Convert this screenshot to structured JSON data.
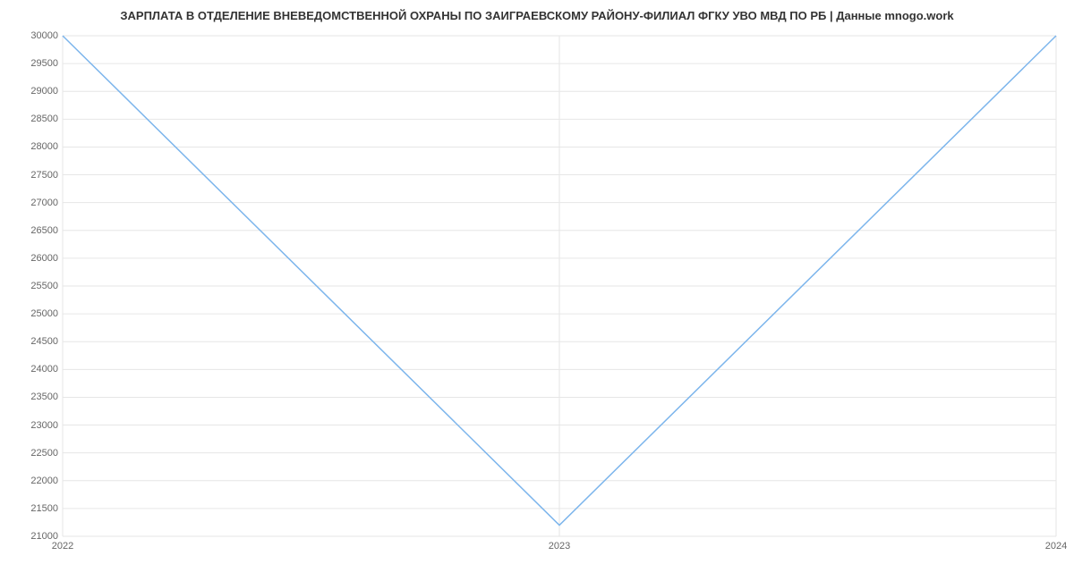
{
  "chart_data": {
    "type": "line",
    "title": "ЗАРПЛАТА В ОТДЕЛЕНИЕ ВНЕВЕДОМСТВЕННОЙ ОХРАНЫ ПО ЗАИГРАЕВСКОМУ РАЙОНУ-ФИЛИАЛ ФГКУ УВО МВД ПО РБ | Данные mnogo.work",
    "x": [
      2022,
      2023,
      2024
    ],
    "values": [
      30000,
      21200,
      30000
    ],
    "x_ticks": [
      2022,
      2023,
      2024
    ],
    "y_ticks": [
      21000,
      21500,
      22000,
      22500,
      23000,
      23500,
      24000,
      24500,
      25000,
      25500,
      26000,
      26500,
      27000,
      27500,
      28000,
      28500,
      29000,
      29500,
      30000
    ],
    "xlabel": "",
    "ylabel": "",
    "ylim": [
      21000,
      30000
    ],
    "xlim": [
      2022,
      2024
    ],
    "line_color": "#7cb5ec"
  }
}
